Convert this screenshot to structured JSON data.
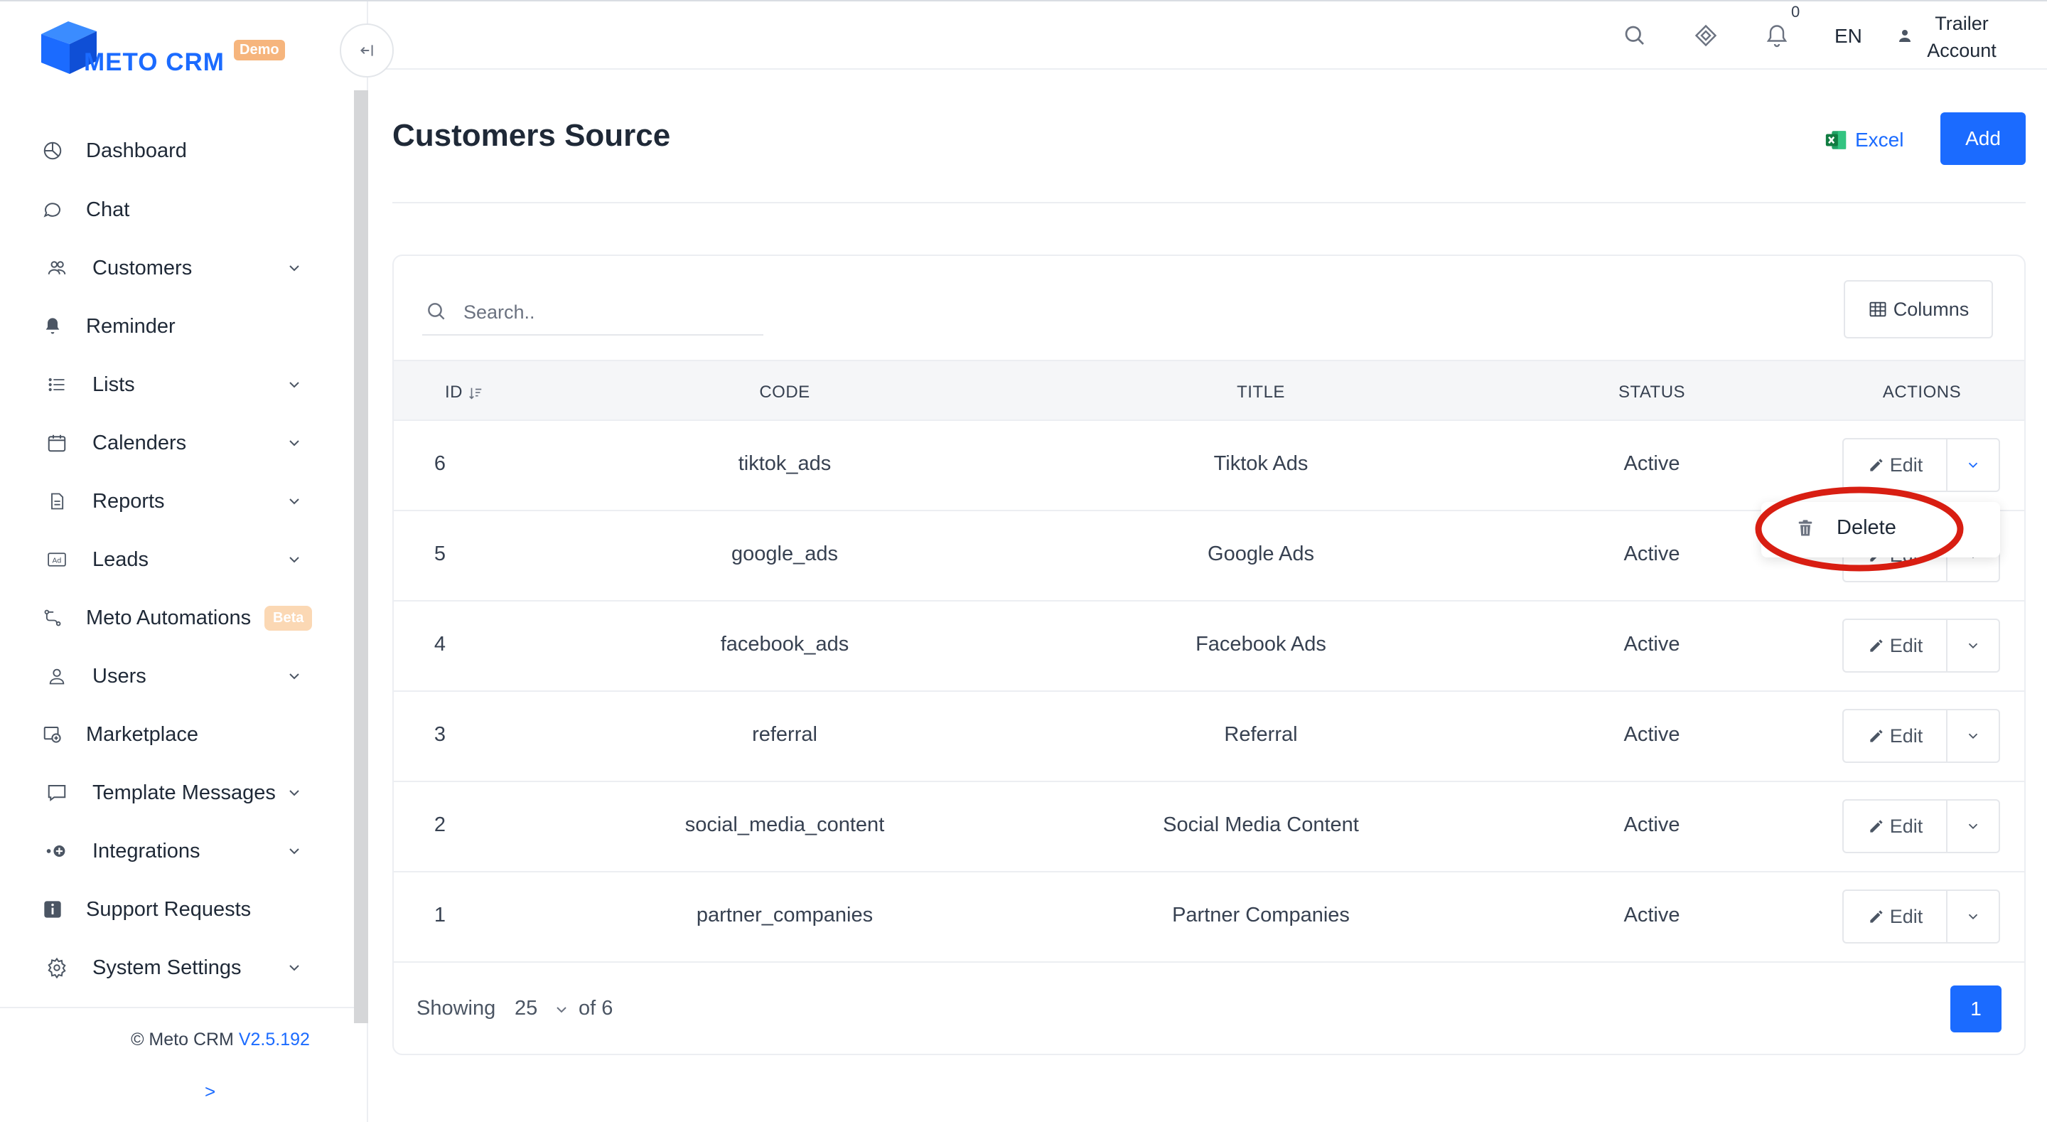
{
  "app": {
    "brand": "METO CRM",
    "brand_badge": "Demo",
    "version_prefix": "© Meto CRM",
    "version": "V2.5.192",
    "expand_label": ">"
  },
  "sidebar": {
    "items": [
      {
        "label": "Dashboard",
        "icon": "pie-chart-icon",
        "has_children": false
      },
      {
        "label": "Chat",
        "icon": "chat-bubble-icon",
        "has_children": false
      },
      {
        "label": "Customers",
        "icon": "users-icon",
        "has_children": true
      },
      {
        "label": "Reminder",
        "icon": "bell-icon",
        "has_children": false
      },
      {
        "label": "Lists",
        "icon": "list-icon",
        "has_children": true
      },
      {
        "label": "Calenders",
        "icon": "calendar-icon",
        "has_children": true
      },
      {
        "label": "Reports",
        "icon": "report-icon",
        "has_children": true
      },
      {
        "label": "Leads",
        "icon": "ad-icon",
        "has_children": true
      },
      {
        "label": "Meto Automations",
        "icon": "automation-icon",
        "has_children": false,
        "badge": "Beta"
      },
      {
        "label": "Users",
        "icon": "user-icon",
        "has_children": true
      },
      {
        "label": "Marketplace",
        "icon": "marketplace-icon",
        "has_children": false
      },
      {
        "label": "Template Messages",
        "icon": "message-template-icon",
        "has_children": true
      },
      {
        "label": "Integrations",
        "icon": "integrations-icon",
        "has_children": true
      },
      {
        "label": "Support Requests",
        "icon": "info-icon",
        "has_children": false
      },
      {
        "label": "System Settings",
        "icon": "gear-icon",
        "has_children": true
      }
    ]
  },
  "topbar": {
    "notification_count": "0",
    "language": "EN",
    "user_line1": "Trailer",
    "user_line2": "Account"
  },
  "page": {
    "title": "Customers Source",
    "excel_label": "Excel",
    "add_label": "Add"
  },
  "table": {
    "search_placeholder": "Search..",
    "columns_label": "Columns",
    "headers": {
      "id": "ID",
      "code": "CODE",
      "title": "TITLE",
      "status": "STATUS",
      "actions": "ACTIONS"
    },
    "edit_label": "Edit",
    "rows": [
      {
        "id": "6",
        "code": "tiktok_ads",
        "title": "Tiktok Ads",
        "status": "Active"
      },
      {
        "id": "5",
        "code": "google_ads",
        "title": "Google Ads",
        "status": "Active"
      },
      {
        "id": "4",
        "code": "facebook_ads",
        "title": "Facebook Ads",
        "status": "Active"
      },
      {
        "id": "3",
        "code": "referral",
        "title": "Referral",
        "status": "Active"
      },
      {
        "id": "2",
        "code": "social_media_content",
        "title": "Social Media Content",
        "status": "Active"
      },
      {
        "id": "1",
        "code": "partner_companies",
        "title": "Partner Companies",
        "status": "Active"
      }
    ],
    "pagination": {
      "showing": "Showing",
      "page_size": "25",
      "of_total": "of 6",
      "current_page": "1"
    }
  },
  "dropdown": {
    "delete_label": "Delete"
  },
  "colors": {
    "accent": "#1b6bff",
    "highlight_ring": "#d81e12",
    "badge_orange": "#f6b57d"
  }
}
